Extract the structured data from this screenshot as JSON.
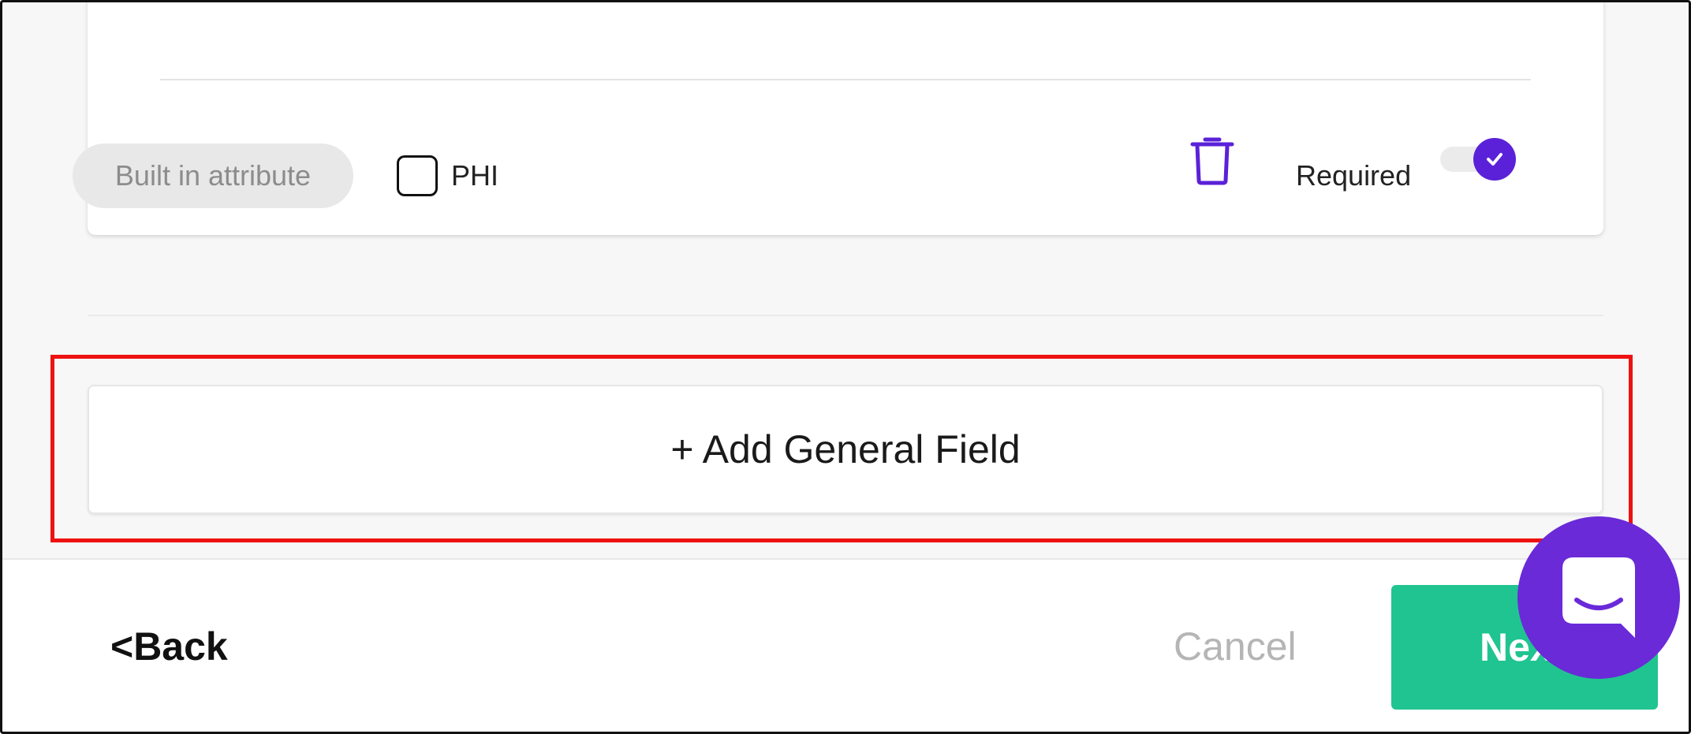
{
  "attribute_card": {
    "badge_label": "Built in attribute",
    "phi_label": "PHI",
    "phi_checked": false,
    "required_label": "Required",
    "required_on": true
  },
  "add_field": {
    "label": "+ Add General Field"
  },
  "footer": {
    "back_label": "<Back",
    "cancel_label": "Cancel",
    "next_label": "Next"
  },
  "colors": {
    "accent_purple": "#5b21d8",
    "next_green": "#20c490",
    "highlight_red": "#ee1111",
    "chat_purple": "#6a2ad8"
  },
  "icons": {
    "delete": "trash-icon",
    "toggle": "checkmark-icon",
    "chat": "chat-bubble-icon"
  }
}
